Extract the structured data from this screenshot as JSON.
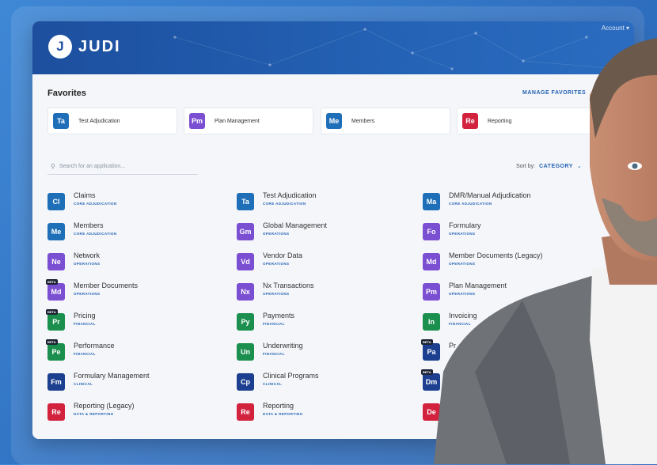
{
  "header": {
    "logo_mark": "J",
    "logo_text": "JUDI",
    "account": "Account ▾"
  },
  "favorites": {
    "title": "Favorites",
    "manage": "MANAGE FAVORITES",
    "items": [
      {
        "abbr": "Ta",
        "label": "Test Adjudication",
        "color": "#1f6fb8"
      },
      {
        "abbr": "Pm",
        "label": "Plan Management",
        "color": "#7b4fd2"
      },
      {
        "abbr": "Me",
        "label": "Members",
        "color": "#1f6fb8"
      },
      {
        "abbr": "Re",
        "label": "Reporting",
        "color": "#d2223e"
      }
    ]
  },
  "search": {
    "icon": "search-icon",
    "placeholder": "Search for an application..."
  },
  "sort": {
    "label": "Sort by:",
    "value": "CATEGORY"
  },
  "apps": {
    "col1": [
      {
        "abbr": "Cl",
        "name": "Claims",
        "cat": "CORE ADJUDICATION",
        "color": "#1f6fb8",
        "beta": ""
      },
      {
        "abbr": "Me",
        "name": "Members",
        "cat": "CORE ADJUDICATION",
        "color": "#1f6fb8",
        "beta": ""
      },
      {
        "abbr": "Ne",
        "name": "Network",
        "cat": "OPERATIONS",
        "color": "#7b4fd2",
        "beta": ""
      },
      {
        "abbr": "Md",
        "name": "Member Documents",
        "cat": "OPERATIONS",
        "color": "#7b4fd2",
        "beta": "BETA"
      },
      {
        "abbr": "Pr",
        "name": "Pricing",
        "cat": "FINANCIAL",
        "color": "#1b8f4e",
        "beta": "BETA"
      },
      {
        "abbr": "Pe",
        "name": "Performance",
        "cat": "FINANCIAL",
        "color": "#1b8f4e",
        "beta": "BETA"
      },
      {
        "abbr": "Fm",
        "name": "Formulary Management",
        "cat": "CLINICAL",
        "color": "#1d3f8f",
        "beta": ""
      },
      {
        "abbr": "Re",
        "name": "Reporting (Legacy)",
        "cat": "DATA & REPORTING",
        "color": "#d2223e",
        "beta": ""
      }
    ],
    "col2": [
      {
        "abbr": "Ta",
        "name": "Test Adjudication",
        "cat": "CORE ADJUDICATION",
        "color": "#1f6fb8",
        "beta": ""
      },
      {
        "abbr": "Gm",
        "name": "Global Management",
        "cat": "OPERATIONS",
        "color": "#7b4fd2",
        "beta": ""
      },
      {
        "abbr": "Vd",
        "name": "Vendor Data",
        "cat": "OPERATIONS",
        "color": "#7b4fd2",
        "beta": ""
      },
      {
        "abbr": "Nx",
        "name": "Nx Transactions",
        "cat": "OPERATIONS",
        "color": "#7b4fd2",
        "beta": ""
      },
      {
        "abbr": "Py",
        "name": "Payments",
        "cat": "FINANCIAL",
        "color": "#1b8f4e",
        "beta": ""
      },
      {
        "abbr": "Un",
        "name": "Underwriting",
        "cat": "FINANCIAL",
        "color": "#1b8f4e",
        "beta": ""
      },
      {
        "abbr": "Cp",
        "name": "Clinical Programs",
        "cat": "CLINICAL",
        "color": "#1d3f8f",
        "beta": ""
      },
      {
        "abbr": "Re",
        "name": "Reporting",
        "cat": "DATA & REPORTING",
        "color": "#d2223e",
        "beta": ""
      }
    ],
    "col3": [
      {
        "abbr": "Ma",
        "name": "DMR/Manual Adjudication",
        "cat": "CORE ADJUDICATION",
        "color": "#1f6fb8",
        "beta": ""
      },
      {
        "abbr": "Fo",
        "name": "Formulary",
        "cat": "OPERATIONS",
        "color": "#7b4fd2",
        "beta": ""
      },
      {
        "abbr": "Md",
        "name": "Member Documents (Legacy)",
        "cat": "OPERATIONS",
        "color": "#7b4fd2",
        "beta": ""
      },
      {
        "abbr": "Pm",
        "name": "Plan Management",
        "cat": "OPERATIONS",
        "color": "#7b4fd2",
        "beta": ""
      },
      {
        "abbr": "In",
        "name": "Invoicing",
        "cat": "FINANCIAL",
        "color": "#1b8f4e",
        "beta": ""
      },
      {
        "abbr": "Pa",
        "name": "Pr",
        "cat": "",
        "color": "#1d3f8f",
        "beta": "BETA"
      },
      {
        "abbr": "Dm",
        "name": "",
        "cat": "",
        "color": "#1d3f8f",
        "beta": "BETA"
      },
      {
        "abbr": "De",
        "name": "",
        "cat": "",
        "color": "#d2223e",
        "beta": ""
      }
    ]
  }
}
